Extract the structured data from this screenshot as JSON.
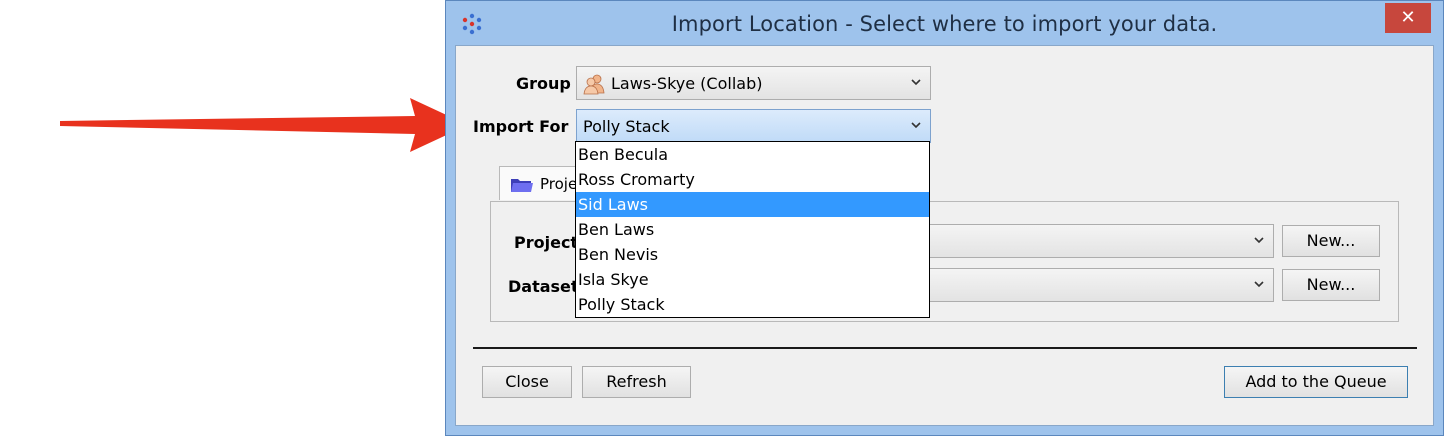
{
  "window": {
    "title": "Import Location - Select where to import your data.",
    "close_glyph": "✕"
  },
  "group": {
    "label": "Group",
    "value": "Laws-Skye (Collab)",
    "icon": "group-icon"
  },
  "import_for": {
    "label": "Import For",
    "value": "Polly Stack",
    "options": [
      "Ben Becula",
      "Ross Cromarty",
      "Sid Laws",
      "Ben Laws",
      "Ben Nevis",
      "Isla Skye",
      "Polly Stack"
    ],
    "highlighted": "Sid Laws"
  },
  "tab": {
    "label": "Projec",
    "icon": "folder-icon"
  },
  "project": {
    "label": "Project",
    "new_label": "New..."
  },
  "dataset": {
    "label": "Dataset",
    "new_label": "New..."
  },
  "footer": {
    "close_label": "Close",
    "refresh_label": "Refresh",
    "add_label": "Add to the Queue"
  },
  "colors": {
    "arrow": "#e8321e",
    "highlight": "#3399ff",
    "frame": "#9ec3ec",
    "close_button": "#c7473d"
  }
}
